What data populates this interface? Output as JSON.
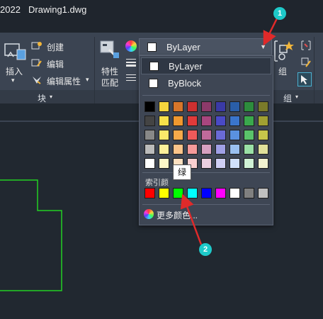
{
  "titlebar": {
    "year": "2022",
    "filename": "Drawing1.dwg"
  },
  "ribbon": {
    "block_panel": {
      "insert_label": "插入",
      "create_label": "创建",
      "edit_label": "编辑",
      "edit_attr_label": "编辑属性",
      "panel_title": "块"
    },
    "properties": {
      "match_label_1": "特性",
      "match_label_2": "匹配"
    },
    "group_panel": {
      "group_label": "组",
      "panel_title": "组"
    }
  },
  "color_combo": {
    "value": "ByLayer",
    "swatch_color": "#ffffff"
  },
  "dropdown": {
    "items": [
      {
        "label": "ByLayer",
        "swatch": "#ffffff"
      },
      {
        "label": "ByBlock",
        "swatch": "#ffffff"
      }
    ],
    "palette_rows": [
      [
        "#000000",
        "#f5d53d",
        "#d8762a",
        "#cc3030",
        "#8c3a6a",
        "#3a3aa6",
        "#2a5ea8",
        "#2d8c3d",
        "#7a7a2a"
      ],
      [
        "#444444",
        "#f7e04a",
        "#f0982f",
        "#e03a3a",
        "#a8467f",
        "#4a4ac6",
        "#3a75cc",
        "#3aa84d",
        "#a0a032"
      ],
      [
        "#888888",
        "#fbe96a",
        "#f7aa4a",
        "#f05a5a",
        "#c06a9a",
        "#6a6ad6",
        "#5a91e0",
        "#5ac46a",
        "#c6c64a"
      ],
      [
        "#bbbbbb",
        "#fcf09a",
        "#fac48a",
        "#f59a9a",
        "#d6a0c0",
        "#a0a0e6",
        "#9ac0f0",
        "#9ae0a6",
        "#e0e09a"
      ],
      [
        "#ffffff",
        "#fdf7c8",
        "#fde0c0",
        "#fad0d0",
        "#ecd0e0",
        "#d0d0f5",
        "#d0e0fa",
        "#d0f2d6",
        "#f2f2d0"
      ]
    ],
    "index_label": "索引颜",
    "index_colors": [
      "#ff0000",
      "#ffff00",
      "#00ff00",
      "#00ffff",
      "#0000ff",
      "#ff00ff",
      "#ffffff",
      "#808080",
      "#c0c0c0"
    ],
    "more_label": "更多颜色..."
  },
  "tooltip": {
    "text": "绿"
  },
  "annotations": {
    "badge_1": "1",
    "badge_2": "2",
    "color": "#1ec9c9",
    "arrow_color": "#e02a2a"
  }
}
